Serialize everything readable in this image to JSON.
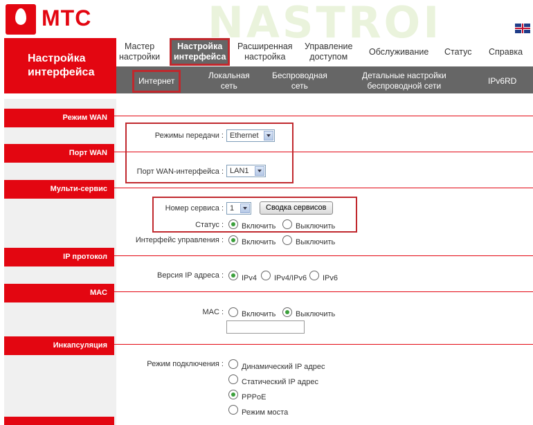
{
  "header": {
    "logo_text": "МТС",
    "watermark": "NASTROI WIFI"
  },
  "section_title": "Настройка интерфейса",
  "topnav": [
    {
      "label": "Мастер\nнастройки"
    },
    {
      "label": "Настройка\nинтерфейса"
    },
    {
      "label": "Расширенная\nнастройка"
    },
    {
      "label": "Управление\nдоступом"
    },
    {
      "label": "Обслуживание"
    },
    {
      "label": "Статус"
    },
    {
      "label": "Справка"
    }
  ],
  "subnav": [
    {
      "label": "Интернет"
    },
    {
      "label": "Локальная\nсеть"
    },
    {
      "label": "Беспроводная\nсеть"
    },
    {
      "label": "Детальные настройки\nбеспроводной сети"
    },
    {
      "label": "IPv6RD"
    }
  ],
  "sidebar": [
    "Режим WAN",
    "Порт WAN",
    "Мульти-сервис",
    "IP протокол",
    "MAC",
    "Инкапсуляция"
  ],
  "form": {
    "transfer_mode": {
      "label": "Режимы передачи :",
      "value": "Ethernet"
    },
    "wan_port": {
      "label": "Порт WAN-интерфейса :",
      "value": "LAN1"
    },
    "service_number": {
      "label": "Номер сервиса :",
      "value": "1",
      "button": "Сводка сервисов"
    },
    "status": {
      "label": "Статус :",
      "on": "Включить",
      "off": "Выключить",
      "selected": "on"
    },
    "mgmt_iface": {
      "label": "Интерфейс управления :",
      "on": "Включить",
      "off": "Выключить",
      "selected": "on"
    },
    "ip_version": {
      "label": "Версия IP адреса :",
      "options": [
        "IPv4",
        "IPv4/IPv6",
        "IPv6"
      ],
      "selected": "IPv4"
    },
    "mac": {
      "label": "MAC :",
      "on": "Включить",
      "off": "Выключить",
      "selected": "off",
      "value": ""
    },
    "connection_mode": {
      "label": "Режим подключения :",
      "options": [
        "Динамический IP адрес",
        "Статический IP адрес",
        "PPPoE",
        "Режим моста"
      ],
      "selected": "PPPoE"
    }
  }
}
